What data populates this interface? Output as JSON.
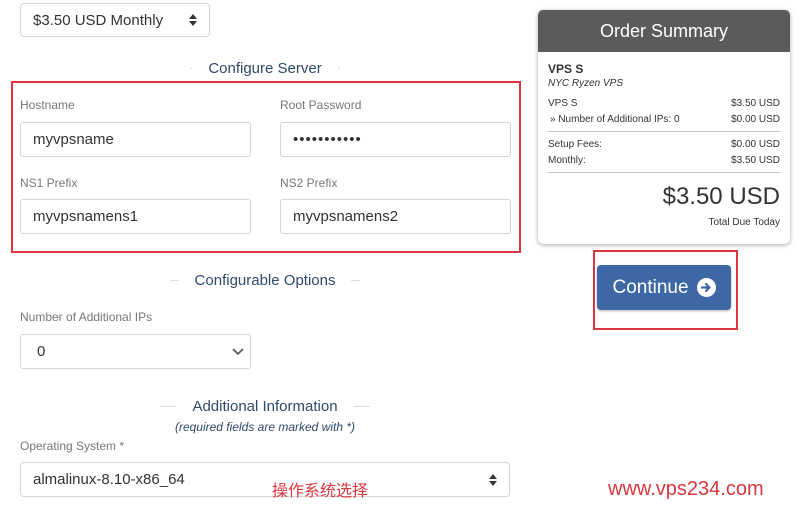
{
  "billing": {
    "selected": "$3.50 USD Monthly"
  },
  "configure_server": {
    "title": "Configure Server",
    "hostname_label": "Hostname",
    "hostname_value": "myvpsname",
    "root_password_label": "Root Password",
    "root_password_value": "•••••••••••",
    "ns1_label": "NS1 Prefix",
    "ns1_value": "myvpsnamens1",
    "ns2_label": "NS2 Prefix",
    "ns2_value": "myvpsnamens2"
  },
  "configurable_options": {
    "title": "Configurable Options",
    "ips_label": "Number of Additional IPs",
    "ips_value": "0"
  },
  "additional_info": {
    "title": "Additional Information",
    "note": "(required fields are marked with *)",
    "os_label": "Operating System *",
    "os_value": "almalinux-8.10-x86_64",
    "os_annotation": "操作系统选择"
  },
  "order_summary": {
    "title": "Order Summary",
    "product": "VPS S",
    "group": "NYC Ryzen VPS",
    "lines": [
      {
        "label": "VPS S",
        "value": "$3.50 USD"
      },
      {
        "label": "» Number of Additional IPs: 0",
        "value": "$0.00 USD"
      }
    ],
    "fees": [
      {
        "label": "Setup Fees:",
        "value": "$0.00 USD"
      },
      {
        "label": "Monthly:",
        "value": "$3.50 USD"
      }
    ],
    "total": "$3.50 USD",
    "total_label": "Total Due Today"
  },
  "continue_label": "Continue",
  "watermark": "www.vps234.com",
  "colors": {
    "accent_button": "#3e68a5",
    "highlight_frame": "#d9363e",
    "heading": "#2f4a6b",
    "summary_header": "#5b5b5b"
  }
}
